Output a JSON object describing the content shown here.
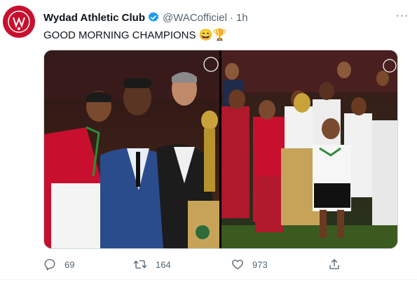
{
  "tweet": {
    "author_name": "Wydad Athletic Club",
    "handle": "@WACofficiel",
    "separator": "·",
    "time": "1h",
    "text": "GOOD MORNING CHAMPIONS",
    "emojis": "😄🏆",
    "more_label": "···"
  },
  "media": {
    "photos": [
      {
        "caption": "Player with medal and flag next to officials and trophy"
      },
      {
        "caption": "Team celebrating with trophy on podium"
      }
    ]
  },
  "actions": {
    "replies": "69",
    "retweets": "164",
    "likes": "973"
  },
  "colors": {
    "brand_red": "#c8102e",
    "verified_blue": "#1d9bf0",
    "muted": "#536471"
  }
}
